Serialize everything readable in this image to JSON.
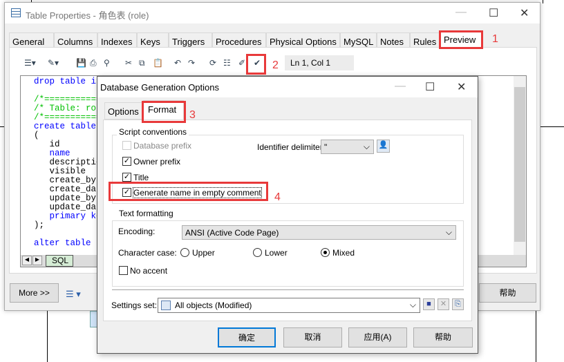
{
  "window": {
    "title": "Table Properties - 角色表 (role)",
    "tabs": [
      "General",
      "Columns",
      "Indexes",
      "Keys",
      "Triggers",
      "Procedures",
      "Physical Options",
      "MySQL",
      "Notes",
      "Rules",
      "Preview"
    ],
    "active_tab": "Preview",
    "status": "Ln 1, Col 1",
    "sheet_tab": "SQL",
    "more_label": "More >>",
    "help_label": "帮助"
  },
  "code": [
    {
      "t": "drop table if",
      "c": "kw"
    },
    {
      "t": "",
      "c": ""
    },
    {
      "t": "/*===========",
      "c": "cm"
    },
    {
      "t": "/* Table: rol",
      "c": "cm"
    },
    {
      "t": "/*===========",
      "c": "cm"
    },
    {
      "t": "create table ",
      "c": "kw"
    },
    {
      "t": "(",
      "c": ""
    },
    {
      "t": "   id",
      "c": ""
    },
    {
      "t": "   name",
      "c": "kw"
    },
    {
      "t": "   descriptio",
      "c": ""
    },
    {
      "t": "   visible",
      "c": ""
    },
    {
      "t": "   create_by",
      "c": ""
    },
    {
      "t": "   create_dat",
      "c": ""
    },
    {
      "t": "   update_by",
      "c": ""
    },
    {
      "t": "   update_dat",
      "c": ""
    },
    {
      "t": "   primary ke",
      "c": "kw"
    },
    {
      "t": ");",
      "c": ""
    },
    {
      "t": "",
      "c": ""
    },
    {
      "t": "alter table r",
      "c": "kw"
    }
  ],
  "dialog": {
    "title": "Database Generation Options",
    "tabs": [
      "Options",
      "Format"
    ],
    "active_tab": "Format",
    "script_group": "Script conventions",
    "checks": [
      {
        "label": "Database prefix",
        "checked": false,
        "disabled": true
      },
      {
        "label": "Owner prefix",
        "checked": true
      },
      {
        "label": "Title",
        "checked": true
      },
      {
        "label": "Generate name in empty comment",
        "checked": true
      }
    ],
    "identifier_label": "Identifier delimiter:",
    "identifier_value": "\"",
    "text_group": "Text formatting",
    "encoding_label": "Encoding:",
    "encoding_value": "ANSI (Active Code Page)",
    "case_label": "Character case:",
    "case_options": [
      "Upper",
      "Lower",
      "Mixed"
    ],
    "case_selected": "Mixed",
    "no_accent": "No accent",
    "settings_label": "Settings set:",
    "settings_value": "All objects (Modified)",
    "buttons": [
      "确定",
      "取消",
      "应用(A)",
      "帮助"
    ]
  },
  "annotations": [
    "1",
    "2",
    "3",
    "4"
  ],
  "colors": {
    "annotation": "#e8393a",
    "keyword": "#0000ff",
    "comment": "#00c000",
    "focus": "#0078d7"
  }
}
